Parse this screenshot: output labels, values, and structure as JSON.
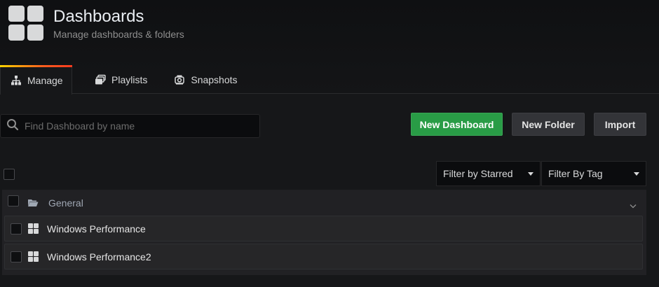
{
  "header": {
    "title": "Dashboards",
    "subtitle": "Manage dashboards & folders",
    "icon": "dashboard-grid-icon"
  },
  "tabs": [
    {
      "label": "Manage",
      "icon": "sitemap-icon",
      "active": true
    },
    {
      "label": "Playlists",
      "icon": "playlist-icon",
      "active": false
    },
    {
      "label": "Snapshots",
      "icon": "snapshot-icon",
      "active": false
    }
  ],
  "search": {
    "placeholder": "Find Dashboard by name",
    "value": ""
  },
  "actions": {
    "new_dashboard": "New Dashboard",
    "new_folder": "New Folder",
    "import": "Import"
  },
  "filters": {
    "starred": "Filter by Starred",
    "tag": "Filter By Tag"
  },
  "folder": {
    "name": "General",
    "dashboards": [
      {
        "name": "Windows Performance"
      },
      {
        "name": "Windows Performance2"
      }
    ]
  },
  "colors": {
    "accent_green": "#299c46",
    "active_tab_gradient_start": "#ffd500",
    "active_tab_gradient_end": "#ff3b1f",
    "background": "#161719"
  }
}
